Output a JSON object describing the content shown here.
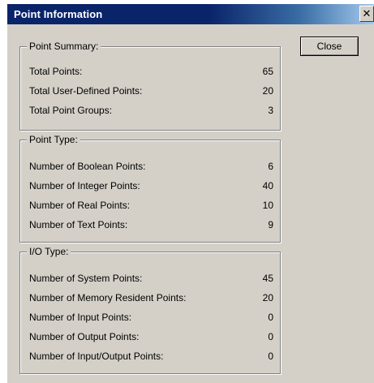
{
  "window": {
    "title": "Point Information",
    "close_glyph": "✕",
    "close_button_label": "Close"
  },
  "groups": [
    {
      "legend": "Point Summary:",
      "rows": [
        {
          "label": "Total Points:",
          "value": "65"
        },
        {
          "label": "Total User-Defined Points:",
          "value": "20"
        },
        {
          "label": "Total Point Groups:",
          "value": "3"
        }
      ]
    },
    {
      "legend": "Point Type:",
      "rows": [
        {
          "label": "Number of Boolean Points:",
          "value": "6"
        },
        {
          "label": "Number of Integer Points:",
          "value": "40"
        },
        {
          "label": "Number of Real Points:",
          "value": "10"
        },
        {
          "label": "Number of Text Points:",
          "value": "9"
        }
      ]
    },
    {
      "legend": "I/O Type:",
      "rows": [
        {
          "label": "Number of System Points:",
          "value": "45"
        },
        {
          "label": "Number of Memory Resident Points:",
          "value": "20"
        },
        {
          "label": "Number of Input Points:",
          "value": "0"
        },
        {
          "label": "Number of Output Points:",
          "value": "0"
        },
        {
          "label": "Number of Input/Output Points:",
          "value": "0"
        }
      ]
    }
  ]
}
